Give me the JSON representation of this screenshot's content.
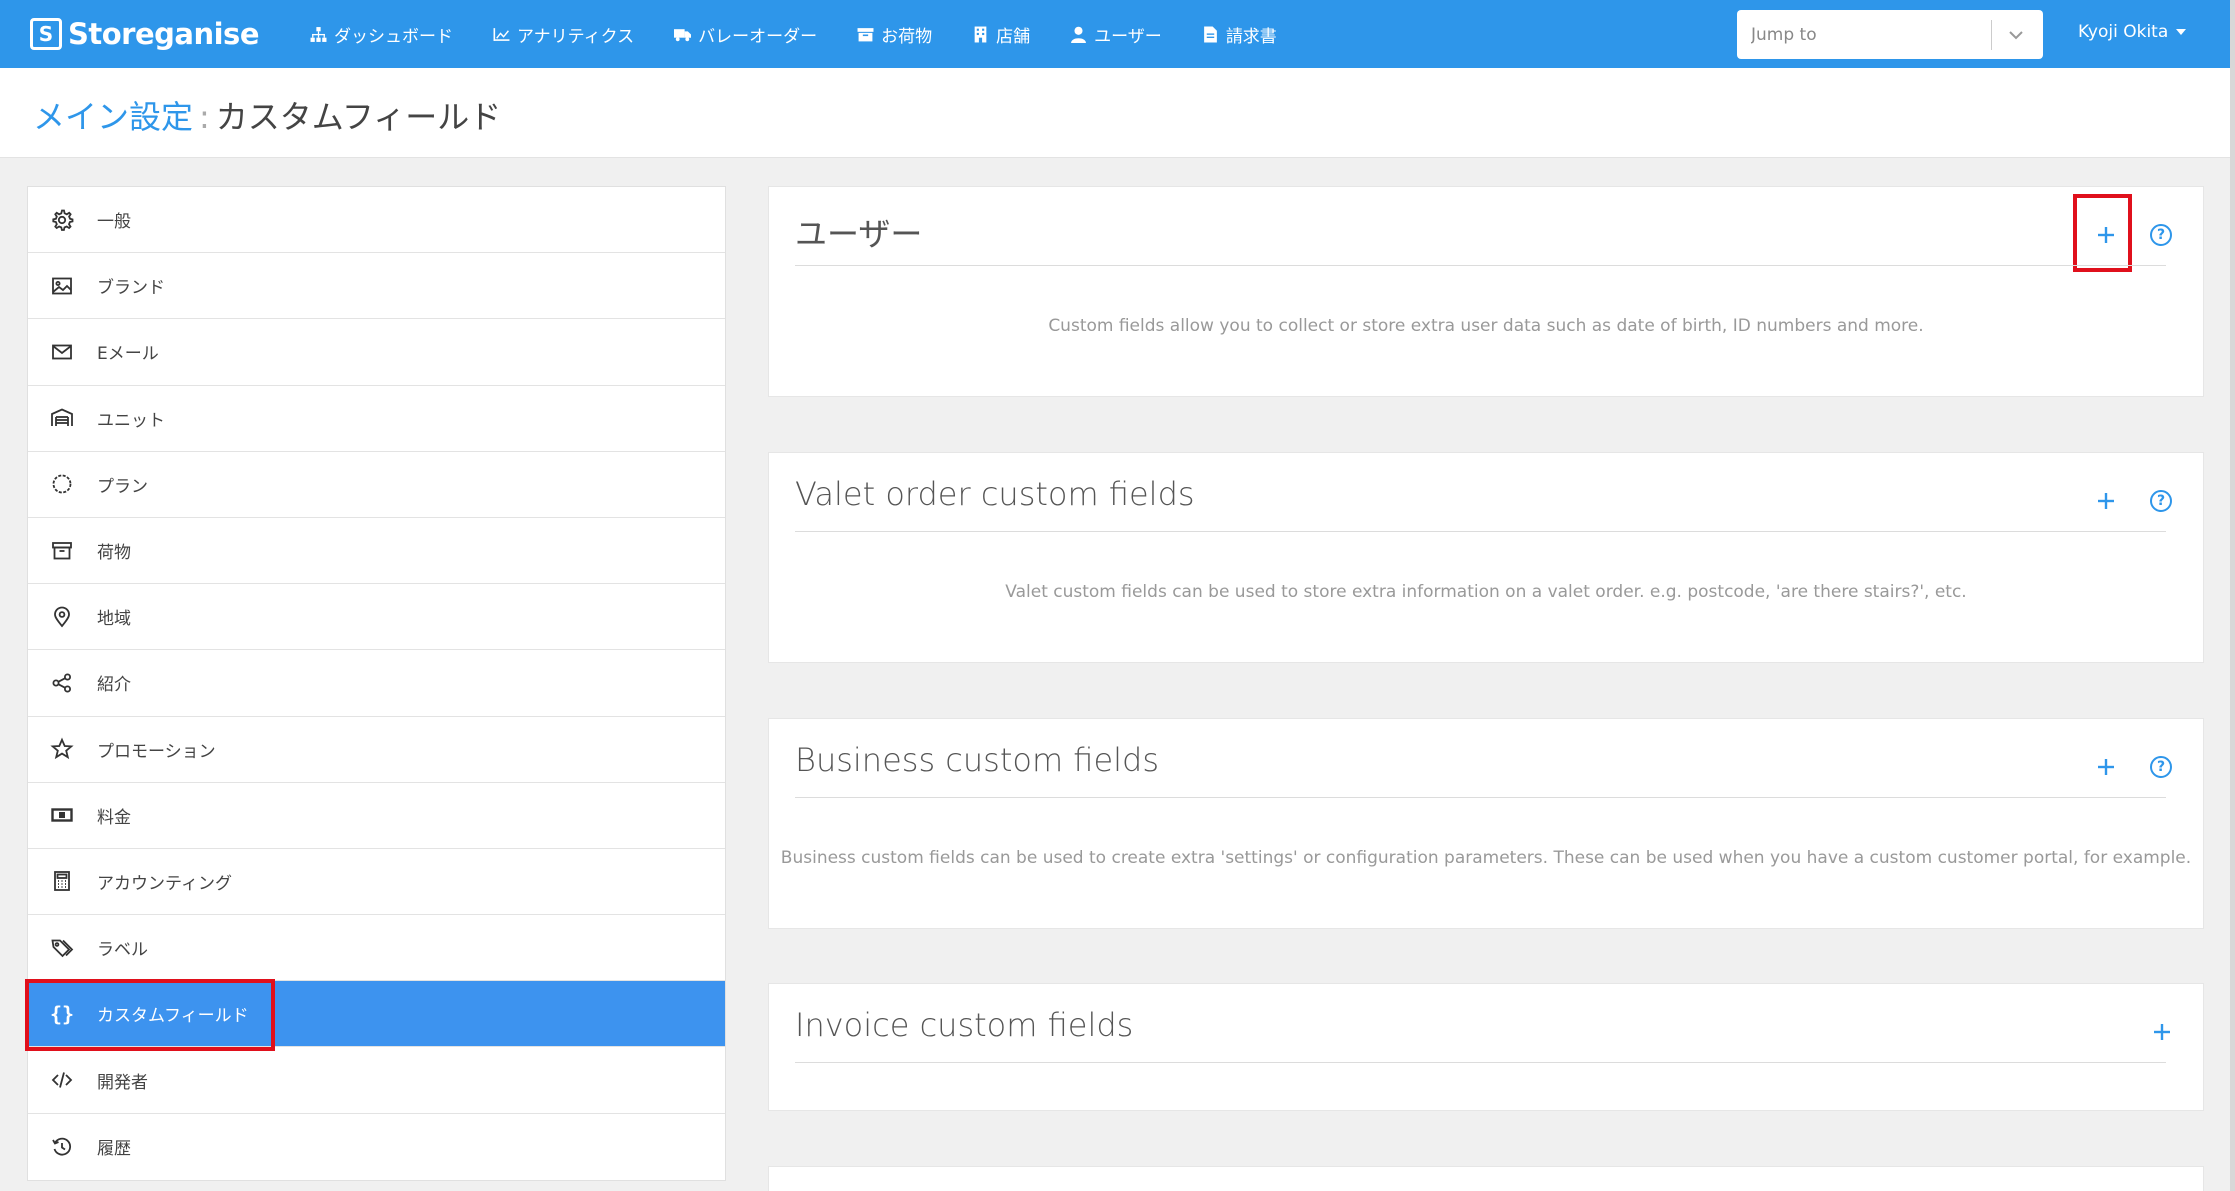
{
  "app": {
    "brand": "Storeganise",
    "logo_glyph": "S"
  },
  "nav": [
    {
      "label": "ダッシュボード",
      "icon": "sitemap-icon"
    },
    {
      "label": "アナリティクス",
      "icon": "chart-icon"
    },
    {
      "label": "バレーオーダー",
      "icon": "truck-icon"
    },
    {
      "label": "お荷物",
      "icon": "archive-icon"
    },
    {
      "label": "店舗",
      "icon": "building-icon"
    },
    {
      "label": "ユーザー",
      "icon": "user-icon"
    },
    {
      "label": "請求書",
      "icon": "invoice-icon"
    }
  ],
  "jump": {
    "placeholder": "Jump to"
  },
  "user": {
    "name": "Kyoji Okita"
  },
  "breadcrumb": {
    "parent": "メイン設定",
    "separator": ":",
    "current": "カスタムフィールド"
  },
  "sidebar": {
    "items": [
      {
        "label": "一般",
        "icon": "gear-icon"
      },
      {
        "label": "ブランド",
        "icon": "image-icon"
      },
      {
        "label": "Eメール",
        "icon": "envelope-icon"
      },
      {
        "label": "ユニット",
        "icon": "warehouse-icon"
      },
      {
        "label": "プラン",
        "icon": "circle-icon"
      },
      {
        "label": "荷物",
        "icon": "archive-icon"
      },
      {
        "label": "地域",
        "icon": "map-pin-icon"
      },
      {
        "label": "紹介",
        "icon": "share-icon"
      },
      {
        "label": "プロモーション",
        "icon": "star-icon"
      },
      {
        "label": "料金",
        "icon": "money-icon"
      },
      {
        "label": "アカウンティング",
        "icon": "calculator-icon"
      },
      {
        "label": "ラベル",
        "icon": "tags-icon"
      },
      {
        "label": "カスタムフィールド",
        "icon": "braces-icon",
        "active": true
      },
      {
        "label": "開発者",
        "icon": "code-icon"
      },
      {
        "label": "履歴",
        "icon": "history-icon"
      }
    ]
  },
  "sections": [
    {
      "title": "ユーザー",
      "description": "Custom fields allow you to collect or store extra user data such as date of birth, ID numbers and more.",
      "has_help": true
    },
    {
      "title": "Valet order custom fields",
      "description": "Valet custom fields can be used to store extra information on a valet order. e.g. postcode, 'are there stairs?', etc.",
      "has_help": true
    },
    {
      "title": "Business custom fields",
      "description": "Business custom fields can be used to create extra 'settings' or configuration parameters. These can be used when you have a custom customer portal, for example.",
      "has_help": true
    },
    {
      "title": "Invoice custom fields",
      "description": "",
      "has_help": false
    }
  ],
  "help_glyph": "?",
  "colors": {
    "primary": "#2e96ea",
    "active": "#3d93ef",
    "highlight": "#e0101c"
  }
}
